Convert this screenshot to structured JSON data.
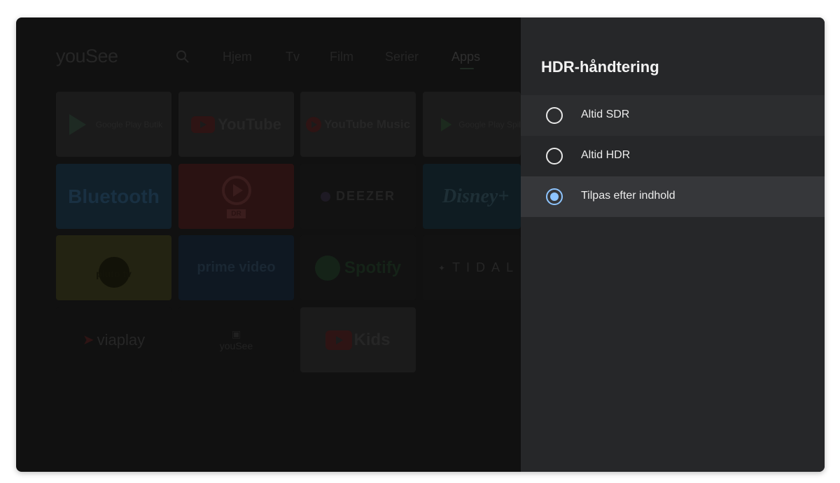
{
  "header": {
    "logo": "youSee",
    "nav": [
      {
        "label": "Hjem"
      },
      {
        "label": "Tv"
      },
      {
        "label": "Film"
      },
      {
        "label": "Serier"
      },
      {
        "label": "Apps",
        "active": true
      }
    ]
  },
  "apps": [
    {
      "label": "Google Play Butik",
      "icon": "google-play-icon"
    },
    {
      "label": "YouTube",
      "icon": "youtube-icon"
    },
    {
      "label": "YouTube Music",
      "icon": "youtube-music-icon"
    },
    {
      "label": "Google Play Spil",
      "icon": "google-play-icon"
    },
    {
      "label": "Bluetooth",
      "icon": "bluetooth-icon"
    },
    {
      "label": "DR",
      "icon": "dr-tv-icon"
    },
    {
      "label": "DEEZER",
      "icon": "deezer-icon"
    },
    {
      "label": "Disney+",
      "icon": "disney-plus-icon"
    },
    {
      "label": "pluto tv",
      "icon": "pluto-tv-icon"
    },
    {
      "label": "prime video",
      "icon": "prime-video-icon"
    },
    {
      "label": "Spotify",
      "icon": "spotify-icon"
    },
    {
      "label": "TIDAL",
      "icon": "tidal-icon"
    },
    {
      "label": "viaplay",
      "icon": "viaplay-icon"
    },
    {
      "label": "youSee",
      "icon": "yousee-icon"
    },
    {
      "label": "Kids",
      "icon": "youtube-kids-icon"
    }
  ],
  "panel": {
    "title": "HDR-håndtering",
    "options": [
      {
        "label": "Altid SDR",
        "checked": false
      },
      {
        "label": "Altid HDR",
        "checked": false
      },
      {
        "label": "Tilpas efter indhold",
        "checked": true
      }
    ]
  },
  "colors": {
    "accent": "#8ec5ff",
    "panel_bg": "#262729",
    "screen_bg": "#111111"
  }
}
